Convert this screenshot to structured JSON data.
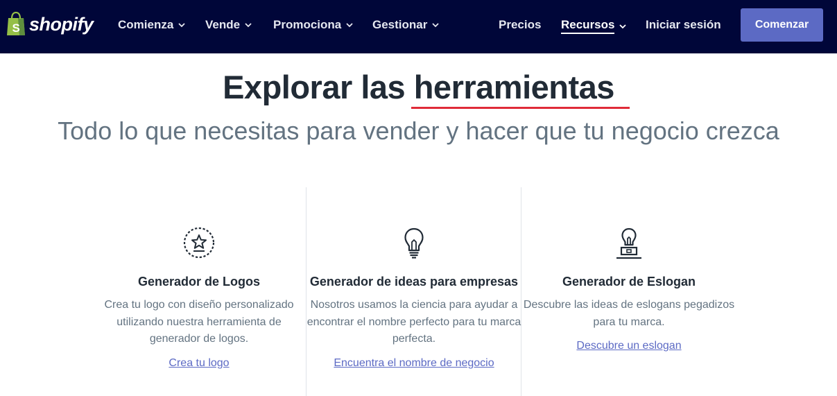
{
  "nav": {
    "brand": "shopify",
    "items": [
      {
        "label": "Comienza",
        "dropdown": true
      },
      {
        "label": "Vende",
        "dropdown": true
      },
      {
        "label": "Promociona",
        "dropdown": true
      },
      {
        "label": "Gestionar",
        "dropdown": true
      }
    ],
    "right": [
      {
        "label": "Precios",
        "dropdown": false
      },
      {
        "label": "Recursos",
        "dropdown": true,
        "active": true
      },
      {
        "label": "Iniciar sesión",
        "dropdown": false
      }
    ],
    "cta": "Comenzar"
  },
  "hero": {
    "title_prefix": "Explorar las ",
    "title_highlight": "herramientas",
    "subtitle": "Todo lo que necesitas para vender y hacer que tu negocio crezca"
  },
  "tools": [
    {
      "icon": "star-badge-icon",
      "title": "Generador de Logos",
      "description": "Crea tu logo con diseño personalizado utilizando nuestra herramienta de generador de logos.",
      "link": "Crea tu logo"
    },
    {
      "icon": "lightbulb-icon",
      "title": "Generador de ideas para empresas",
      "description": "Nosotros usamos la ciencia para ayudar a encontrar el nombre perfecto para tu marca perfecta.",
      "link": "Encuentra el nombre de negocio"
    },
    {
      "icon": "lightbulb-stand-icon",
      "title": "Generador de Eslogan",
      "description": "Descubre las ideas de eslogans pegadizos para tu marca.",
      "link": "Descubre un eslogan"
    }
  ],
  "colors": {
    "nav_bg": "#000639",
    "accent": "#5c6ac4",
    "underline": "#e02b38",
    "text": "#212b36",
    "muted": "#637381",
    "brand_green": "#95bf47"
  }
}
